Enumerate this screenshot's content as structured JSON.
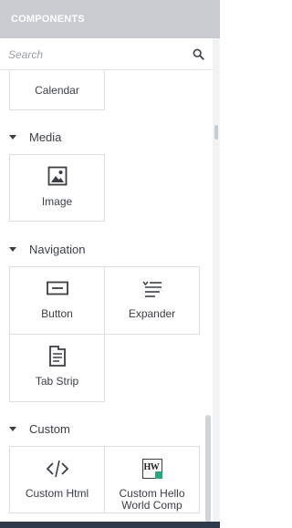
{
  "header": {
    "title": "COMPONENTS"
  },
  "search": {
    "placeholder": "Search"
  },
  "partial_section": {
    "items": [
      {
        "label": "Calendar",
        "icon": "calendar-icon"
      }
    ]
  },
  "sections": [
    {
      "name": "Media",
      "items": [
        {
          "label": "Image",
          "icon": "image-icon"
        }
      ]
    },
    {
      "name": "Navigation",
      "items": [
        {
          "label": "Button",
          "icon": "button-icon"
        },
        {
          "label": "Expander",
          "icon": "expander-icon"
        },
        {
          "label": "Tab Strip",
          "icon": "tab-strip-icon"
        }
      ]
    },
    {
      "name": "Custom",
      "items": [
        {
          "label": "Custom Html",
          "icon": "code-icon"
        },
        {
          "label": "Custom Hello World Comp",
          "icon": "hello-world-icon",
          "icon_text": "HW"
        }
      ]
    }
  ]
}
